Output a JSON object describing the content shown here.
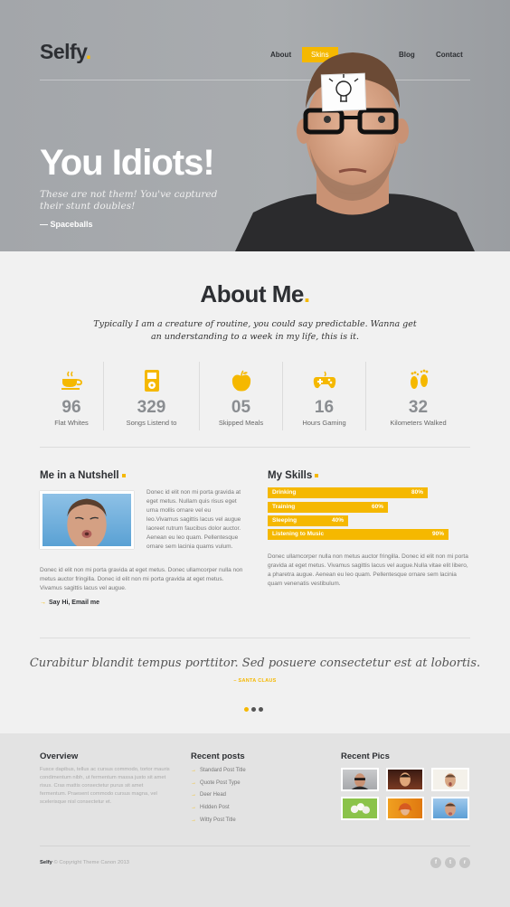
{
  "header": {
    "logo": "Selfy",
    "logo_dot": ".",
    "nav": [
      "About",
      "Skins",
      "Blog",
      "Contact"
    ],
    "nav_active": "Skins",
    "accent": "#f5b800"
  },
  "hero": {
    "title": "You Idiots!",
    "quote": "These are not them! You've captured their stunt doubles!",
    "author": "— Spaceballs"
  },
  "about": {
    "title": "About Me",
    "title_dot": ".",
    "intro": "Typically I am a creature of routine, you could say predictable. Wanna get an understanding to a week in my life, this is it.",
    "stats": [
      {
        "icon": "coffee-cup-icon",
        "value": "96",
        "label": "Flat Whites"
      },
      {
        "icon": "music-player-icon",
        "value": "329",
        "label": "Songs Listend to"
      },
      {
        "icon": "apple-icon",
        "value": "05",
        "label": "Skipped Meals"
      },
      {
        "icon": "gamepad-icon",
        "value": "16",
        "label": "Hours Gaming"
      },
      {
        "icon": "footprints-icon",
        "value": "32",
        "label": "Kilometers Walked"
      }
    ]
  },
  "nutshell": {
    "title": "Me in a Nutshell",
    "side_text": "Donec id elit non mi porta gravida at eget metus. Nullam quis risus eget urna mollis ornare vel eu leo.Vivamus sagittis lacus vel augue laoreet rutrum faucibus dolor auctor. Aenean eu leo quam. Pellentesque ornare sem lacinia quams vulum.",
    "body_text": "Donec id elit non mi porta gravida at eget metus. Donec ullamcorper nulla non metus auctor fringilla. Donec id elit non mi porta gravida at eget metus. Vivamus sagittis lacus vel augue.",
    "link": "Say Hi, Email me"
  },
  "skills": {
    "title": "My Skills",
    "items": [
      {
        "label": "Drinking",
        "percent_text": "80%",
        "value": 0.8
      },
      {
        "label": "Training",
        "percent_text": "60%",
        "value": 0.6
      },
      {
        "label": "Sleeping",
        "percent_text": "40%",
        "value": 0.4
      },
      {
        "label": "Listening to Music",
        "percent_text": "90%",
        "value": 0.9
      }
    ],
    "text": "Donec ullamcorper nulla non metus auctor fringilla. Donec id elit non mi porta gravida at eget metus. Vivamus sagittis lacus vel augue.Nulla vitae elit libero, a pharetra augue. Aenean eu leo quam. Pellentesque ornare sem lacinia quam venenatis vestibulum."
  },
  "testimonial": {
    "quote": "Curabitur blandit tempus porttitor. Sed posuere consectetur est at lobortis.",
    "author": "– SANTA CLAUS",
    "active_dot": 1,
    "dot_count": 3
  },
  "footer": {
    "overview_title": "Overview",
    "overview_text": "Fusce dapibus, tellus ac cursus commodo, tortor mauris condimentum nibh, ut fermentum massa justo sit amet risus. Cras mattis consectetur purus sit amet fermentum. Praesent commodo cursus magna, vel scelerisque nisl consectetur et.",
    "posts_title": "Recent posts",
    "posts": [
      "Standard Post Title",
      "Quote Post Type",
      "Deer Head",
      "Hidden Post",
      "Witty Post Title"
    ],
    "pics_title": "Recent Pics",
    "copyright_brand": "Selfy",
    "copyright": " © Copyright Theme Canon 2013",
    "social": [
      "facebook-icon",
      "twitter-icon",
      "rss-icon"
    ],
    "social_glyphs": [
      "f",
      "t",
      "r"
    ]
  }
}
